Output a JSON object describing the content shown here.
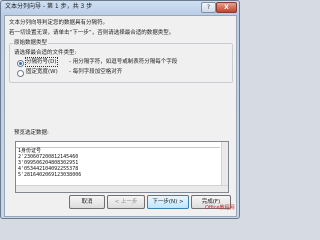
{
  "window": {
    "title": "文本分列向导 - 第 1 步，共 3 步",
    "help_label": "?",
    "close_label": "X"
  },
  "intro": {
    "line1": "文本分列向导判定您的数据具有分隔符。",
    "line2": "若一切设置无误，请单击“下一步”，否则请选择最合适的数据类型。"
  },
  "original_type_group": {
    "label": "原始数据类型",
    "instruction": "请选择最合适的文件类型:",
    "options": [
      {
        "label": "分隔符号(D)",
        "description": "- 用分隔字符，如逗号或制表符分隔每个字段",
        "selected": true
      },
      {
        "label": "固定宽度(W)",
        "description": "- 每列字段加空格对齐",
        "selected": false
      }
    ]
  },
  "preview": {
    "label": "预览选定数据:",
    "rows": [
      {
        "num": "1",
        "text": "身份证号"
      },
      {
        "num": "2",
        "text": "'230607200812145460"
      },
      {
        "num": "3",
        "text": "'099506204808302951"
      },
      {
        "num": "4",
        "text": "'053442104092255378"
      },
      {
        "num": "5",
        "text": "'2816402069123038006"
      }
    ]
  },
  "buttons": {
    "cancel": "取消",
    "back": "< 上一步",
    "next": "下一步(N) >",
    "finish": "完成(F)"
  },
  "watermark": "Office教程网"
}
